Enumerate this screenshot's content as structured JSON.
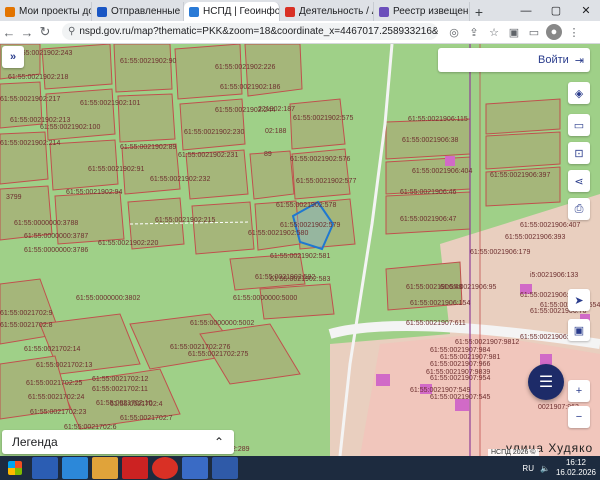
{
  "browser": {
    "tabs": [
      {
        "title": "Мои проекты до",
        "active": false
      },
      {
        "title": "Отправленные -",
        "active": false
      },
      {
        "title": "НСПД | Геоинфо",
        "active": true
      },
      {
        "title": "Деятельность / А",
        "active": false
      },
      {
        "title": "Реестр извещени",
        "active": false
      }
    ],
    "url": "nspd.gov.ru/map?thematic=PKK&zoom=18&coordinate_x=4467017.258933216&coordinat..."
  },
  "map": {
    "login_label": "Войти",
    "legend_label": "Легенда",
    "street_label": "улица Худяко",
    "attribution": "НСПД 2026 ©",
    "parcels": [
      {
        "label": "61:55:0021902:243"
      },
      {
        "label": "61:55:0021902:90"
      },
      {
        "label": "61:55:0021902:218"
      },
      {
        "label": "61:55:0021902:226"
      },
      {
        "label": "61:55:0021902:186"
      },
      {
        "label": "61:55:0021902:217"
      },
      {
        "label": "61:55:0021902:101"
      },
      {
        "label": "61:55:0021902:244"
      },
      {
        "label": "221902:187"
      },
      {
        "label": "61:55:0021902:575"
      },
      {
        "label": "61:55:0021902:213"
      },
      {
        "label": "61:55:0021902:100"
      },
      {
        "label": "61:55:0021902:230"
      },
      {
        "label": "02:188"
      },
      {
        "label": "61:55:0021902:214"
      },
      {
        "label": "61:55:0021902:89"
      },
      {
        "label": "61:55:0021902:91"
      },
      {
        "label": "61:55:0021902:231"
      },
      {
        "label": "89"
      },
      {
        "label": "61:55:0021902:576"
      },
      {
        "label": "61:55:0021902:232"
      },
      {
        "label": "61:55:0021902:577"
      },
      {
        "label": "61:55:0021902:94"
      },
      {
        "label": "61:55:0021902:578"
      },
      {
        "label": "3799"
      },
      {
        "label": "61:55:0021902:215"
      },
      {
        "label": "61:55:0021902:579"
      },
      {
        "label": "61:55:0000000:3788"
      },
      {
        "label": "61:55:0000000:3787"
      },
      {
        "label": "61:55:0021902:580"
      },
      {
        "label": "61:55:0021902:220"
      },
      {
        "label": "61:55:0000000:3786"
      },
      {
        "label": "61:55:0021902:581"
      },
      {
        "label": "61:55:0021902:582"
      },
      {
        "label": "61:55:0021902:583"
      },
      {
        "label": "61:55:0000000:3802"
      },
      {
        "label": "61:55:0000000:5000"
      },
      {
        "label": "61:55:0000000:5002"
      },
      {
        "label": "61:55:0021702:9"
      },
      {
        "label": "61:55:0021702:8"
      },
      {
        "label": "61:55:0021702:276"
      },
      {
        "label": "61:55:0021702:14"
      },
      {
        "label": "61:55:0021702:275"
      },
      {
        "label": "61:55:0021702:13"
      },
      {
        "label": "61:55:0021702:12"
      },
      {
        "label": "61:55:0021702:25"
      },
      {
        "label": "61:55:0021702:11"
      },
      {
        "label": "61:55:0021702:24"
      },
      {
        "label": "61:55:0021702:10"
      },
      {
        "label": "61:55:0021702:23"
      },
      {
        "label": "61:55:0021702:4"
      },
      {
        "label": "61:55:0021702:7"
      },
      {
        "label": "61:55:0021702:6"
      },
      {
        "label": "2:289"
      },
      {
        "label": "61:55:0021906:115"
      },
      {
        "label": "61:55:0021906:38"
      },
      {
        "label": "61:55:0021906:404"
      },
      {
        "label": "61:55:0021906:397"
      },
      {
        "label": "61:55:0021906:46"
      },
      {
        "label": "61:55:0021906:47"
      },
      {
        "label": "61:55:0021906:407"
      },
      {
        "label": "61:55:0021906:393"
      },
      {
        "label": "61:55:0021906:179"
      },
      {
        "label": "i5:0021906:133"
      },
      {
        "label": "61:55:0021906:48"
      },
      {
        "label": "61:55:0021906:95"
      },
      {
        "label": "61:55:0021906:421"
      },
      {
        "label": "61:55:0021906:76"
      },
      {
        "label": "61:55:0021906:154"
      },
      {
        "label": "61:55:0021906:5549"
      },
      {
        "label": "61:55:0021907:611"
      },
      {
        "label": "61:55:0021906:5320"
      },
      {
        "label": "61:55:0021907:9812"
      },
      {
        "label": "61:55:0021907:984"
      },
      {
        "label": "61:55:0021907:981"
      },
      {
        "label": "61:55:0021907:966"
      },
      {
        "label": "61:55:0021907:9839"
      },
      {
        "label": "61:55:0021907:954"
      },
      {
        "label": "61:55:0021907:549"
      },
      {
        "label": "61:55:0021907:545"
      },
      {
        "label": "0021907:963"
      }
    ]
  },
  "taskbar": {
    "lang": "RU",
    "time": "16:12",
    "date": "16.02.2026"
  },
  "colors": {
    "map_green": "#9fd088",
    "parcel_fill": "#a5b67a",
    "parcel_border": "#c0504d",
    "selected_border": "#1f78d1",
    "residential_pink": "#f6cfc9",
    "road_white": "#f4f4f4",
    "accent_navy": "#1d2b68"
  },
  "icons": [
    "expand-icon",
    "login-icon",
    "layers-icon",
    "ruler-icon",
    "measure-icon",
    "share-icon",
    "print-icon",
    "locate-icon",
    "zoom-in-icon",
    "zoom-out-icon",
    "chat-icon"
  ]
}
